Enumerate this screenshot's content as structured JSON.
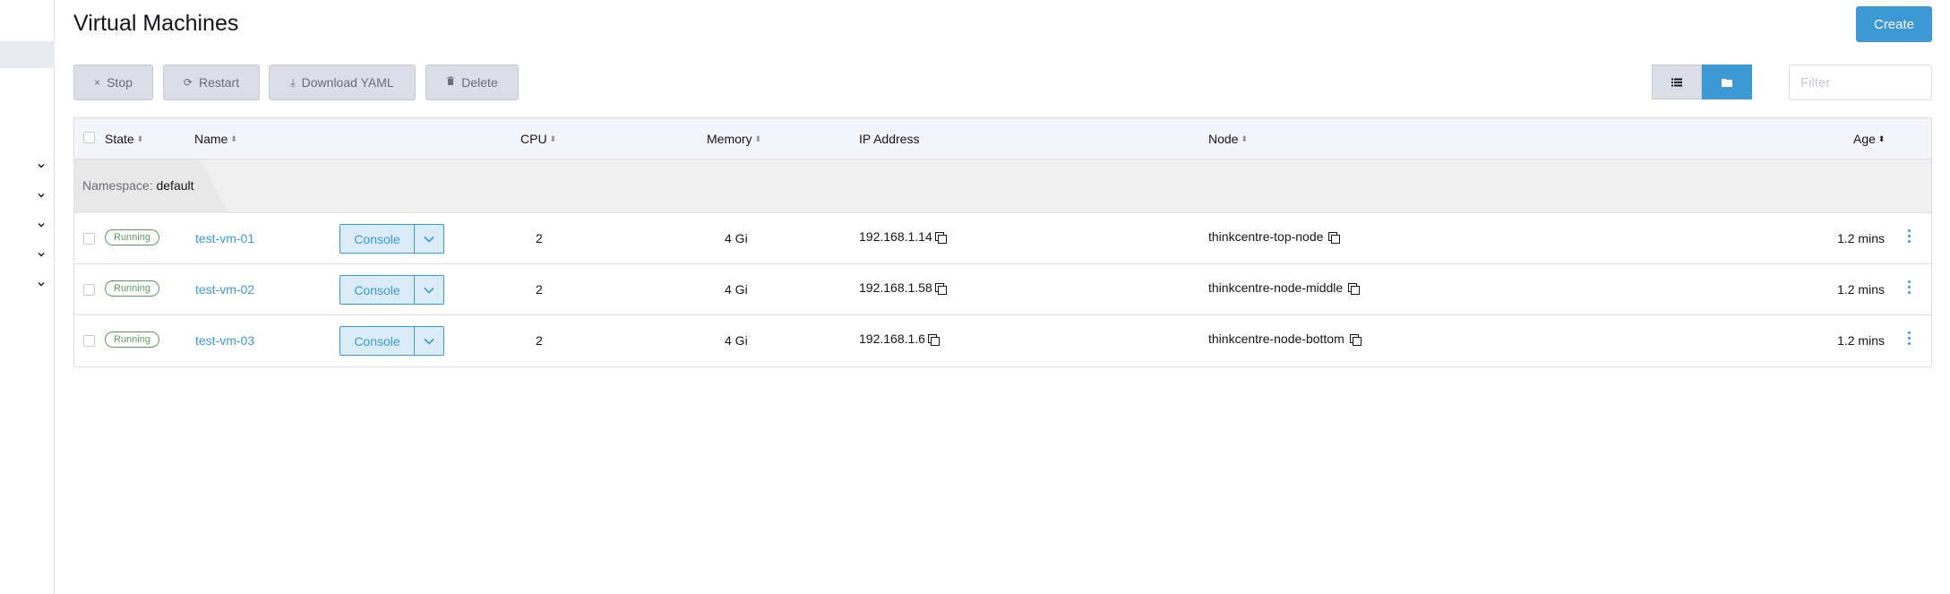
{
  "page": {
    "title": "Virtual Machines",
    "create_label": "Create"
  },
  "bulk_actions": [
    {
      "label": "Stop",
      "icon": "close-icon",
      "glyph": "×"
    },
    {
      "label": "Restart",
      "icon": "refresh-icon",
      "glyph": "⟳"
    },
    {
      "label": "Download YAML",
      "icon": "download-icon",
      "glyph": "⤓"
    },
    {
      "label": "Delete",
      "icon": "trash-icon",
      "glyph": "🗑"
    }
  ],
  "view_toggle": {
    "list_icon": "list-icon",
    "folder_icon": "folder-icon",
    "active": "folder"
  },
  "filter": {
    "placeholder": "Filter",
    "value": ""
  },
  "table": {
    "headers": {
      "state": "State",
      "name": "Name",
      "cpu": "CPU",
      "memory": "Memory",
      "ip": "IP Address",
      "node": "Node",
      "age": "Age"
    },
    "group": {
      "prefix": "Namespace:",
      "name": "default"
    },
    "rows": [
      {
        "state": "Running",
        "name": "test-vm-01",
        "console": "Console",
        "cpu": "2",
        "memory": "4 Gi",
        "ip": "192.168.1.14",
        "node": "thinkcentre-top-node",
        "age": "1.2 mins"
      },
      {
        "state": "Running",
        "name": "test-vm-02",
        "console": "Console",
        "cpu": "2",
        "memory": "4 Gi",
        "ip": "192.168.1.58",
        "node": "thinkcentre-node-middle",
        "age": "1.2 mins"
      },
      {
        "state": "Running",
        "name": "test-vm-03",
        "console": "Console",
        "cpu": "2",
        "memory": "4 Gi",
        "ip": "192.168.1.6",
        "node": "thinkcentre-node-bottom",
        "age": "1.2 mins"
      }
    ]
  },
  "colors": {
    "accent": "#3d98d3",
    "running": "#5d995d",
    "button_bg": "#dcdee7"
  }
}
